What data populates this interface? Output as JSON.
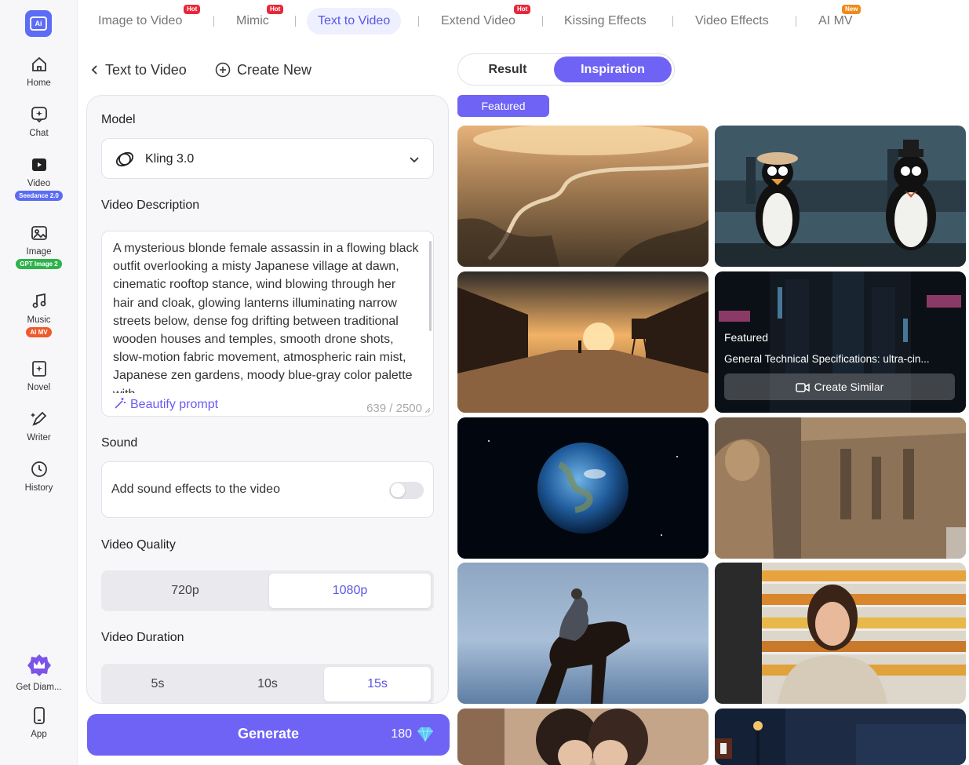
{
  "sidebar": {
    "logo_text": "Ai",
    "items": [
      {
        "label": "Home",
        "icon": "home-icon"
      },
      {
        "label": "Chat",
        "icon": "chat-icon"
      },
      {
        "label": "Video",
        "icon": "video-icon",
        "badge": "Seedance 2.0",
        "badge_color": "#5b6cf0"
      },
      {
        "label": "Image",
        "icon": "image-icon",
        "badge": "GPT Image 2",
        "badge_color": "#2fb24c"
      },
      {
        "label": "Music",
        "icon": "music-icon",
        "badge": "AI MV",
        "badge_color": "#ef5a2b"
      },
      {
        "label": "Novel",
        "icon": "novel-icon"
      },
      {
        "label": "Writer",
        "icon": "writer-icon"
      },
      {
        "label": "History",
        "icon": "history-icon"
      },
      {
        "label": "Get Diam...",
        "icon": "diamond-crown-icon"
      },
      {
        "label": "App",
        "icon": "phone-icon"
      }
    ]
  },
  "tabs": [
    {
      "label": "Image to Video",
      "badge": "Hot"
    },
    {
      "label": "Mimic",
      "badge": "Hot"
    },
    {
      "label": "Text to Video",
      "active": true
    },
    {
      "label": "Extend Video",
      "badge": "Hot"
    },
    {
      "label": "Kissing Effects"
    },
    {
      "label": "Video Effects"
    },
    {
      "label": "AI MV",
      "badge": "New"
    }
  ],
  "header": {
    "back_label": "Text to Video",
    "create_label": "Create New"
  },
  "form": {
    "model_label": "Model",
    "model_value": "Kling 3.0",
    "description_label": "Video Description",
    "description_text": "A mysterious blonde female assassin in a flowing black outfit overlooking a misty Japanese village at dawn, cinematic rooftop stance, wind blowing through her hair and cloak, glowing lanterns illuminating narrow streets below, dense fog drifting between traditional wooden houses and temples, smooth drone shots, slow-motion fabric movement, atmospheric rain mist, Japanese zen gardens, moody blue-gray color palette with",
    "beautify_label": "Beautify prompt",
    "char_count": "639 / 2500",
    "sound_label": "Sound",
    "sound_option": "Add sound effects to the video",
    "sound_enabled": false,
    "quality_label": "Video Quality",
    "quality_options": [
      "720p",
      "1080p"
    ],
    "quality_selected": "1080p",
    "duration_label": "Video Duration",
    "duration_options": [
      "5s",
      "10s",
      "15s"
    ],
    "duration_selected": "15s"
  },
  "generate": {
    "label": "Generate",
    "cost": "180",
    "cost_icon": "diamond-icon"
  },
  "right": {
    "result_label": "Result",
    "inspiration_label": "Inspiration",
    "active": "Inspiration",
    "filter_chip": "Featured",
    "hover_card": {
      "tag": "Featured",
      "title": "General Technical Specifications: ultra-cin...",
      "button": "Create Similar"
    },
    "thumbnails": [
      "aerial-river-sunset",
      "cartoon-penguins-city",
      "western-town-sunset",
      "neon-city-street",
      "earth-from-space",
      "egyptian-temple-statues",
      "horse-rider-sky",
      "woman-grocery-store",
      "couple-closeup",
      "city-street-night"
    ]
  }
}
